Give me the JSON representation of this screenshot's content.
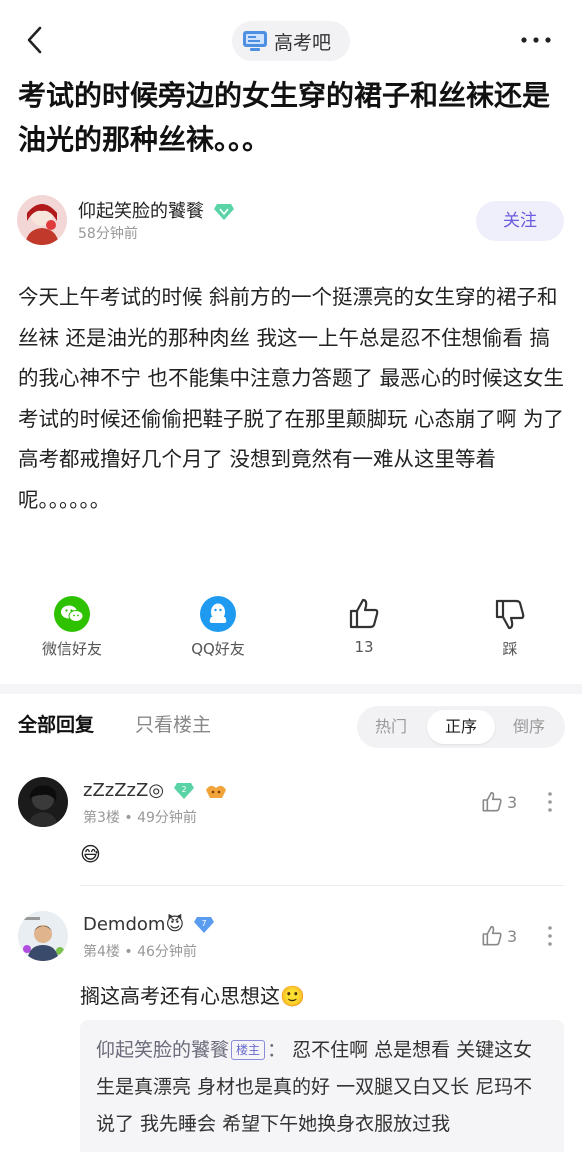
{
  "header": {
    "forum_name": "高考吧",
    "back_icon": "chevron-left-icon",
    "more_icon": "more-horizontal-icon"
  },
  "post": {
    "title": "考试的时候旁边的女生穿的裙子和丝袜还是油光的那种丝袜。。。",
    "author": {
      "name": "仰起笑脸的饕餮",
      "time": "58分钟前",
      "follow_label": "关注"
    },
    "body": "今天上午考试的时候 斜前方的一个挺漂亮的女生穿的裙子和丝袜 还是油光的那种肉丝 我这一上午总是忍不住想偷看 搞的我心神不宁 也不能集中注意力答题了 最恶心的时候这女生考试的时候还偷偷把鞋子脱了在那里颠脚玩 心态崩了啊 为了高考都戒撸好几个月了 没想到竟然有一难从这里等着呢。。。。。。"
  },
  "actions": {
    "wechat_label": "微信好友",
    "qq_label": "QQ好友",
    "like_count": "13",
    "dislike_label": "踩"
  },
  "tabs": {
    "all_replies": "全部回复",
    "only_op": "只看楼主",
    "sort_hot": "热门",
    "sort_asc": "正序",
    "sort_desc": "倒序"
  },
  "replies": [
    {
      "name": "zZzZzZ◎",
      "level": "2",
      "floor": "第3楼",
      "time": "49分钟前",
      "likes": "3",
      "text": "😅"
    },
    {
      "name": "Demdom😈",
      "level": "7",
      "floor": "第4楼",
      "time": "46分钟前",
      "likes": "3",
      "text": "搁这高考还有心思想这🙂",
      "quote": {
        "name": "仰起笑脸的饕餮",
        "tag": "楼主",
        "text": "忍不住啊 总是想看 关键这女生是真漂亮 身材也是真的好 一双腿又白又长 尼玛不说了 我先睡会 希望下午她换身衣服放过我"
      }
    }
  ],
  "colors": {
    "accent": "#6a5be0",
    "wechat": "#2dc100",
    "qq": "#1e9bf0"
  }
}
